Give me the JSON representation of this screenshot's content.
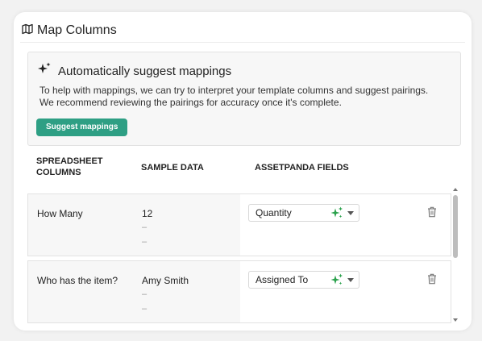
{
  "header": {
    "title": "Map Columns",
    "icon": "map-icon"
  },
  "suggest": {
    "title": "Automatically suggest mappings",
    "line1": "To help with mappings, we can try to interpret your template columns and suggest pairings.",
    "line2": "We recommend reviewing the pairings for accuracy once it's complete.",
    "button_label": "Suggest mappings",
    "accent": "#2e9f84"
  },
  "columns": {
    "spreadsheet_line1": "SPREADSHEET",
    "spreadsheet_line2": "COLUMNS",
    "sample": "SAMPLE DATA",
    "fields": "ASSETPANDA FIELDS"
  },
  "rows": [
    {
      "column": "How Many",
      "samples": [
        "12",
        "–",
        "–"
      ],
      "field": "Quantity"
    },
    {
      "column": "Who has the item?",
      "samples": [
        "Amy Smith",
        "–",
        "–"
      ],
      "field": "Assigned To"
    }
  ],
  "colors": {
    "sparkle_green": "#2aa14c",
    "row_bg": "#f7f7f7"
  }
}
